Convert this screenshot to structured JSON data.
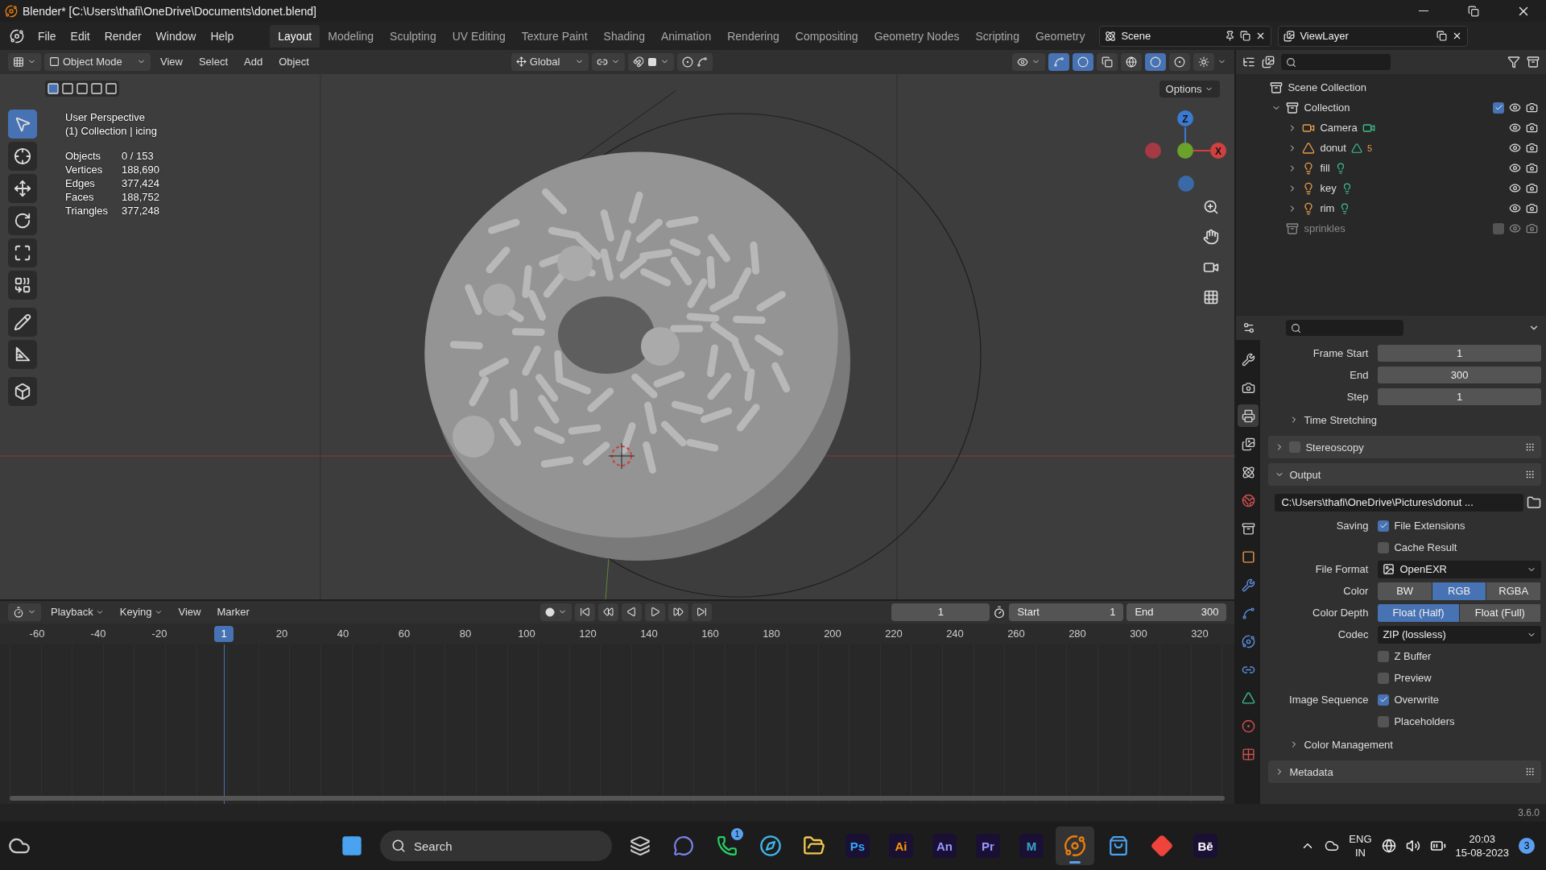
{
  "window": {
    "title": "Blender* [C:\\Users\\thafi\\OneDrive\\Documents\\donet.blend]"
  },
  "menu": [
    "File",
    "Edit",
    "Render",
    "Window",
    "Help"
  ],
  "workspaces": [
    {
      "label": "Layout",
      "selected": true
    },
    {
      "label": "Modeling",
      "selected": false
    },
    {
      "label": "Sculpting",
      "selected": false
    },
    {
      "label": "UV Editing",
      "selected": false
    },
    {
      "label": "Texture Paint",
      "selected": false
    },
    {
      "label": "Shading",
      "selected": false
    },
    {
      "label": "Animation",
      "selected": false
    },
    {
      "label": "Rendering",
      "selected": false
    },
    {
      "label": "Compositing",
      "selected": false
    },
    {
      "label": "Geometry Nodes",
      "selected": false
    },
    {
      "label": "Scripting",
      "selected": false
    },
    {
      "label": "Geometry",
      "selected": false
    }
  ],
  "scene": "Scene",
  "view_layer": "ViewLayer",
  "viewport_header": {
    "mode": "Object Mode",
    "menus": [
      "View",
      "Select",
      "Add",
      "Object"
    ],
    "orientation": "Global",
    "options": "Options",
    "shading": [
      {
        "kind": "wireframe",
        "selected": false
      },
      {
        "kind": "solid",
        "selected": true
      },
      {
        "kind": "material",
        "selected": false
      },
      {
        "kind": "rendered",
        "selected": false
      }
    ]
  },
  "tools": [
    {
      "kind": "select",
      "selected": true
    },
    {
      "kind": "cursor",
      "selected": false
    },
    {
      "kind": "move",
      "selected": false
    },
    {
      "kind": "rotate",
      "selected": false
    },
    {
      "kind": "scale",
      "selected": false
    },
    {
      "kind": "transform",
      "selected": false
    },
    {
      "kind": "annotate",
      "selected": false
    },
    {
      "kind": "measure",
      "selected": false
    },
    {
      "kind": "add_cube",
      "selected": false
    }
  ],
  "overlay": {
    "title": "User Perspective",
    "subtitle": "(1) Collection | icing",
    "stats": [
      {
        "label": "Objects",
        "value": "0 / 153"
      },
      {
        "label": "Vertices",
        "value": "188,690"
      },
      {
        "label": "Edges",
        "value": "377,424"
      },
      {
        "label": "Faces",
        "value": "188,752"
      },
      {
        "label": "Triangles",
        "value": "377,248"
      }
    ]
  },
  "gizmo": {
    "z_label": "Z",
    "x_label": "X"
  },
  "outliner": {
    "items": [
      {
        "name": "Scene Collection",
        "kind": "scene",
        "children": [
          {
            "name": "Collection",
            "kind": "collection",
            "expanded": true,
            "checked": true,
            "children": [
              {
                "name": "Camera",
                "kind": "camera",
                "expanded": false
              },
              {
                "name": "donut",
                "kind": "mesh",
                "expanded": false,
                "badge": "5"
              },
              {
                "name": "fill",
                "kind": "light",
                "expanded": false
              },
              {
                "name": "key",
                "kind": "light",
                "expanded": false
              },
              {
                "name": "rim",
                "kind": "light",
                "expanded": false
              }
            ]
          },
          {
            "name": "sprinkles",
            "kind": "collection",
            "checked": false,
            "disabled": true
          }
        ]
      }
    ]
  },
  "properties": {
    "tabs": [
      {
        "kind": "tool",
        "selected": false
      },
      {
        "kind": "render",
        "selected": false
      },
      {
        "kind": "output",
        "selected": true
      },
      {
        "kind": "view_layer",
        "selected": false
      },
      {
        "kind": "scene",
        "selected": false
      },
      {
        "kind": "world",
        "selected": false
      },
      {
        "kind": "collection",
        "selected": false
      },
      {
        "kind": "object",
        "selected": false
      },
      {
        "kind": "modifiers",
        "selected": false
      },
      {
        "kind": "particles",
        "selected": false
      },
      {
        "kind": "physics",
        "selected": false
      },
      {
        "kind": "constraints",
        "selected": false
      },
      {
        "kind": "data",
        "selected": false
      },
      {
        "kind": "material",
        "selected": false
      },
      {
        "kind": "texture",
        "selected": false
      }
    ],
    "rows": [
      {
        "kind": "number",
        "label": "Frame Start",
        "value": "1"
      },
      {
        "kind": "number",
        "label": "End",
        "value": "300"
      },
      {
        "kind": "number",
        "label": "Step",
        "value": "1"
      },
      {
        "kind": "subpanel",
        "label": "Time Stretching",
        "expanded": false
      },
      {
        "kind": "panel",
        "label": "Stereoscopy",
        "expanded": false,
        "checked": false
      },
      {
        "kind": "panel",
        "label": "Output",
        "expanded": true
      },
      {
        "kind": "path",
        "value": "C:\\Users\\thafi\\OneDrive\\Pictures\\donut ..."
      },
      {
        "kind": "checkbox",
        "label": "Saving",
        "text": "File Extensions",
        "checked": true
      },
      {
        "kind": "checkbox",
        "text": "Cache Result",
        "checked": false
      },
      {
        "kind": "image_dropdown",
        "label": "File Format",
        "value": "OpenEXR"
      },
      {
        "kind": "segmented",
        "label": "Color",
        "options": [
          {
            "label": "BW",
            "selected": false
          },
          {
            "label": "RGB",
            "selected": true
          },
          {
            "label": "RGBA",
            "selected": false
          }
        ]
      },
      {
        "kind": "segmented",
        "label": "Color Depth",
        "options": [
          {
            "label": "Float (Half)",
            "selected": true
          },
          {
            "label": "Float (Full)",
            "selected": false
          }
        ]
      },
      {
        "kind": "dropdown",
        "label": "Codec",
        "value": "ZIP (lossless)"
      },
      {
        "kind": "checkbox",
        "text": "Z Buffer",
        "checked": false
      },
      {
        "kind": "checkbox",
        "text": "Preview",
        "checked": false
      },
      {
        "kind": "checkbox",
        "label": "Image Sequence",
        "text": "Overwrite",
        "checked": true
      },
      {
        "kind": "checkbox",
        "text": "Placeholders",
        "checked": false
      },
      {
        "kind": "subpanel",
        "label": "Color Management",
        "expanded": false
      },
      {
        "kind": "panel",
        "label": "Metadata",
        "expanded": false
      }
    ]
  },
  "timeline": {
    "menus": [
      "Playback",
      "Keying",
      "View",
      "Marker"
    ],
    "current_frame": "1",
    "start_label": "Start",
    "start": "1",
    "end_label": "End",
    "end": "300",
    "ticks": [
      "-60",
      "-40",
      "-20",
      "20",
      "40",
      "60",
      "80",
      "100",
      "120",
      "140",
      "160",
      "180",
      "200",
      "220",
      "240",
      "260",
      "280",
      "300",
      "320"
    ],
    "playhead": "1"
  },
  "status_bar": {
    "version": "3.6.0"
  },
  "taskbar": {
    "search": "Search",
    "apps": [
      {
        "kind": "task_view"
      },
      {
        "kind": "chat"
      },
      {
        "kind": "whatsapp",
        "badge": "1"
      },
      {
        "kind": "edge"
      },
      {
        "kind": "explorer"
      },
      {
        "kind": "lettered",
        "label": "Ps",
        "color": "#31a8ff"
      },
      {
        "kind": "lettered",
        "label": "Ai",
        "color": "#ff9a00"
      },
      {
        "kind": "lettered",
        "label": "An",
        "color": "#9999ff"
      },
      {
        "kind": "lettered",
        "label": "Pr",
        "color": "#9999ff"
      },
      {
        "kind": "lettered",
        "label": "M",
        "color": "#37a5cc"
      },
      {
        "kind": "blender",
        "selected": true
      },
      {
        "kind": "store"
      },
      {
        "kind": "anydesk"
      },
      {
        "kind": "lettered",
        "label": "Bē",
        "color": "#ffffff"
      }
    ],
    "language": "ENG",
    "region": "IN",
    "time": "20:03",
    "date": "15-08-2023",
    "notifications": "3"
  }
}
